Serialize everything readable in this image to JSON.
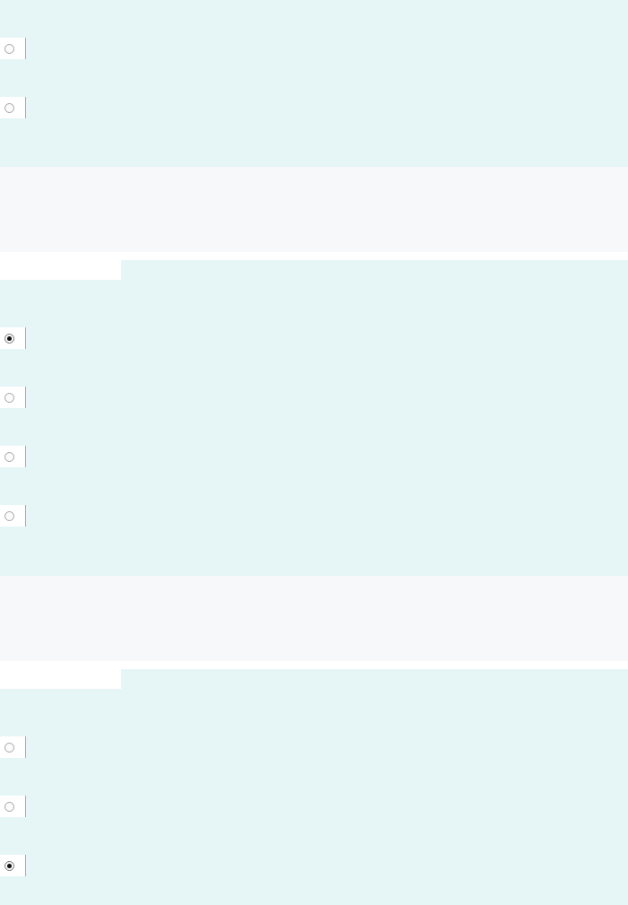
{
  "questions": [
    {
      "header_tab": false,
      "options": [
        {
          "selected": false
        },
        {
          "selected": false
        }
      ]
    },
    {
      "header_tab": true,
      "options": [
        {
          "selected": true
        },
        {
          "selected": false
        },
        {
          "selected": false
        },
        {
          "selected": false
        }
      ]
    },
    {
      "header_tab": true,
      "options": [
        {
          "selected": false
        },
        {
          "selected": false
        },
        {
          "selected": true
        }
      ]
    }
  ]
}
